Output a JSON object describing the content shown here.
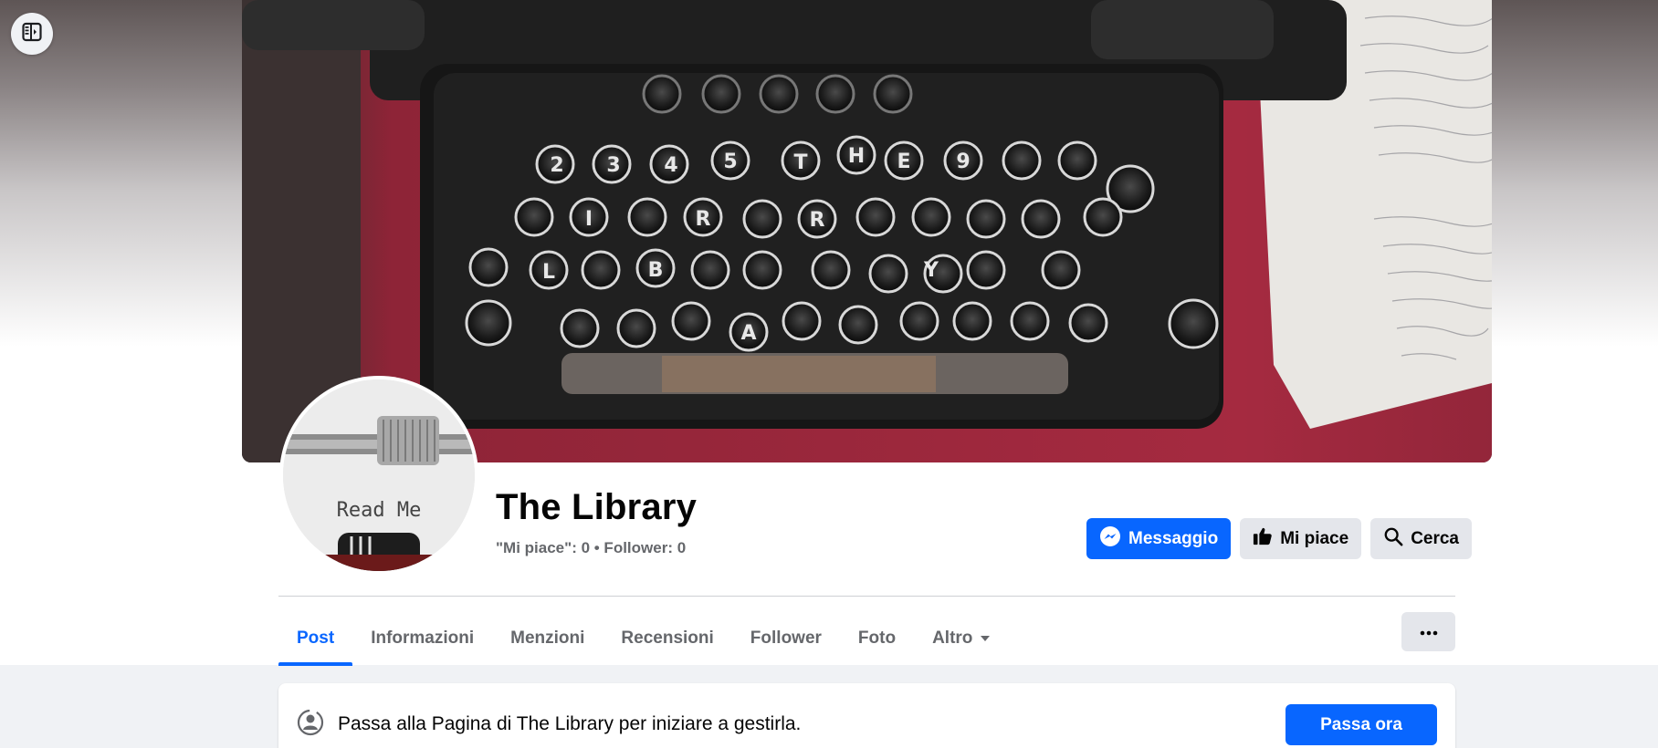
{
  "page": {
    "title": "The Library",
    "stats": "\"Mi piace\": 0 • Follower: 0",
    "avatar_text": "Read Me"
  },
  "actions": {
    "message_label": "Messaggio",
    "like_label": "Mi piace",
    "search_label": "Cerca"
  },
  "tabs": [
    {
      "label": "Post",
      "active": true
    },
    {
      "label": "Informazioni"
    },
    {
      "label": "Menzioni"
    },
    {
      "label": "Recensioni"
    },
    {
      "label": "Follower"
    },
    {
      "label": "Foto"
    },
    {
      "label": "Altro"
    }
  ],
  "manage": {
    "text": "Passa alla Pagina di The Library per iniziare a gestirla.",
    "button_label": "Passa ora"
  },
  "colors": {
    "accent": "#0866ff",
    "secondary_button": "#e4e6eb",
    "muted_text": "#65676b"
  }
}
